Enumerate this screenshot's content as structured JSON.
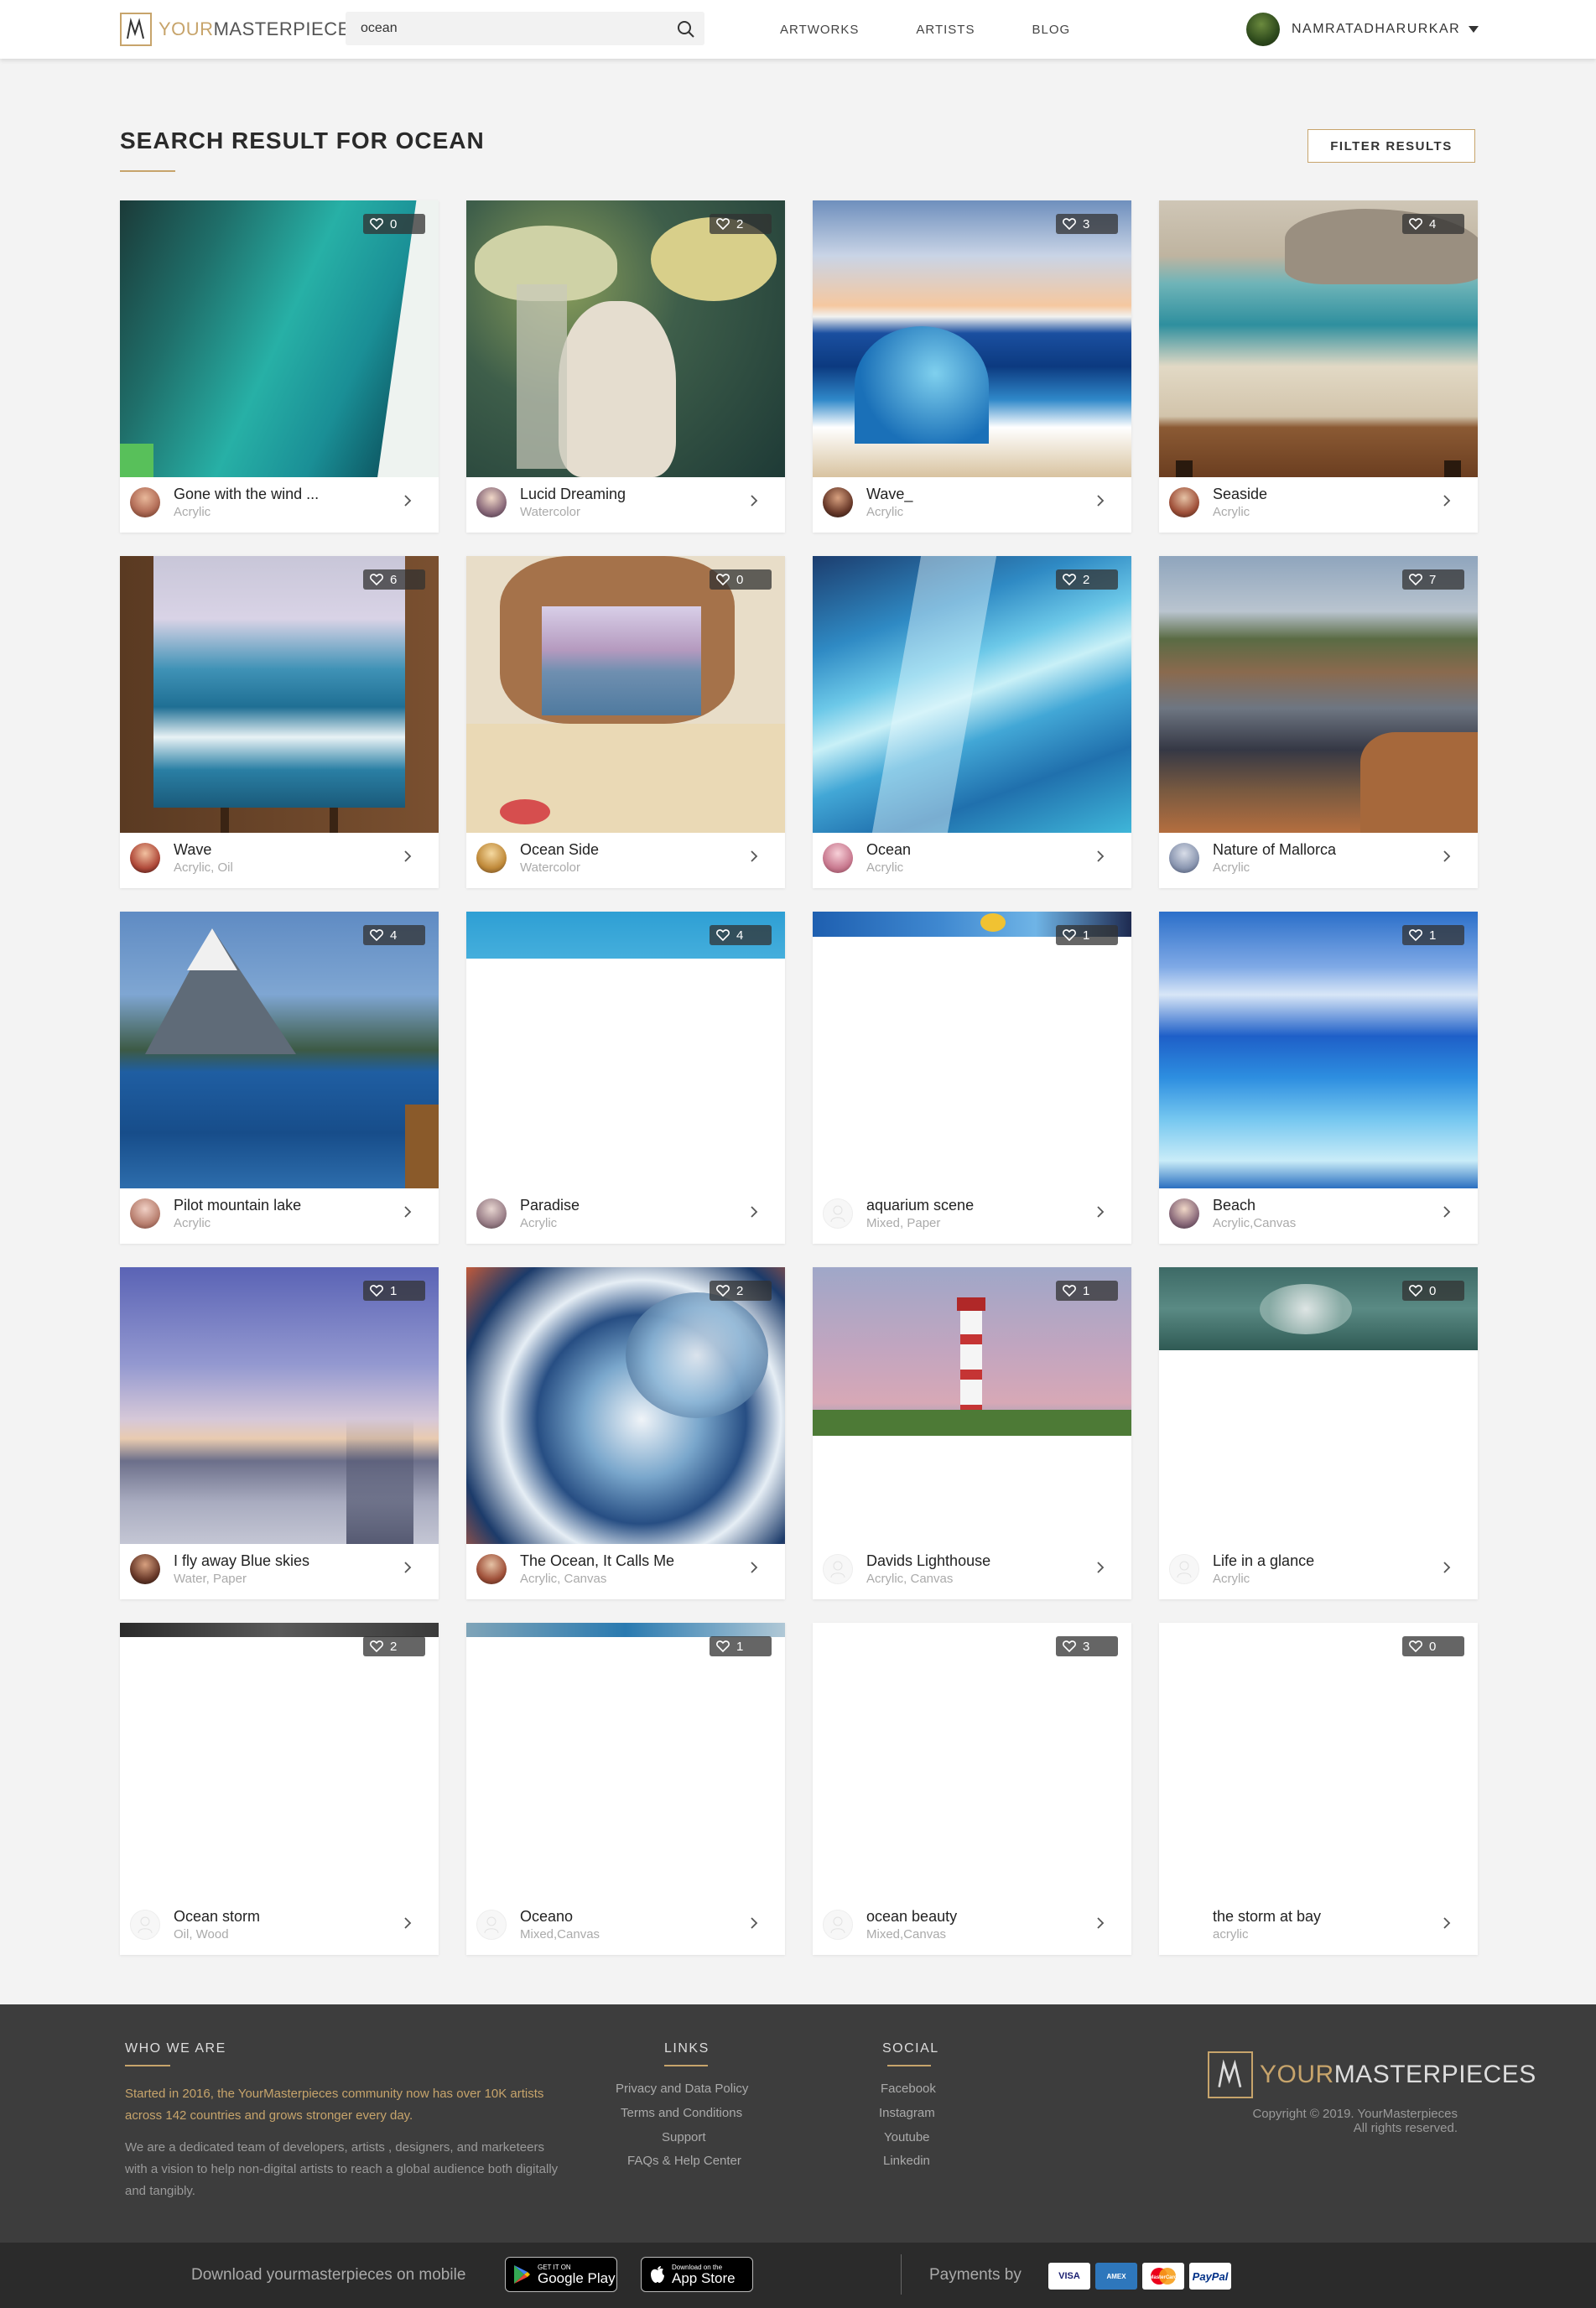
{
  "header": {
    "logo_your": "YOUR",
    "logo_rest": "MASTERPIECES",
    "search_value": "ocean",
    "nav": [
      "ARTWORKS",
      "ARTISTS",
      "BLOG"
    ],
    "user_name": "NAMRATADHARURKAR"
  },
  "main": {
    "title": "SEARCH RESULT FOR OCEAN",
    "filter_label": "FILTER RESULTS"
  },
  "artworks": [
    {
      "title": "Gone with the wind ...",
      "medium": "Acrylic",
      "likes": "0",
      "image": "green-teal-abstract",
      "image_fill": 1.0,
      "avatar": "photo"
    },
    {
      "title": "Lucid Dreaming",
      "medium": "Watercolor",
      "likes": "2",
      "image": "jellyfish-woman",
      "image_fill": 1.0,
      "avatar": "photo"
    },
    {
      "title": "Wave_",
      "medium": "Acrylic",
      "likes": "3",
      "image": "blue-wave",
      "image_fill": 1.0,
      "avatar": "photo"
    },
    {
      "title": "Seaside",
      "medium": "Acrylic",
      "likes": "4",
      "image": "seaside-rocks",
      "image_fill": 1.0,
      "avatar": "photo"
    },
    {
      "title": "Wave",
      "medium": "Acrylic, Oil",
      "likes": "6",
      "image": "wave-on-easel",
      "image_fill": 1.0,
      "avatar": "photo"
    },
    {
      "title": "Ocean Side",
      "medium": "Watercolor",
      "likes": "0",
      "image": "rock-arch-beach",
      "image_fill": 1.0,
      "avatar": "photo"
    },
    {
      "title": "Ocean",
      "medium": "Acrylic",
      "likes": "2",
      "image": "blue-pour",
      "image_fill": 1.0,
      "avatar": "photo"
    },
    {
      "title": "Nature of Mallorca",
      "medium": "Acrylic",
      "likes": "7",
      "image": "mallorca-coast",
      "image_fill": 1.0,
      "avatar": "photo"
    },
    {
      "title": "Pilot mountain lake",
      "medium": "Acrylic",
      "likes": "4",
      "image": "mountain-lake",
      "image_fill": 1.0,
      "avatar": "photo"
    },
    {
      "title": "Paradise",
      "medium": "Acrylic",
      "likes": "4",
      "image": "sea-strip",
      "image_fill": 0.17,
      "avatar": "photo"
    },
    {
      "title": "aquarium scene",
      "medium": "Mixed, Paper",
      "likes": "1",
      "image": "aquarium-strip",
      "image_fill": 0.09,
      "avatar": "placeholder"
    },
    {
      "title": "Beach",
      "medium": "Acrylic,Canvas",
      "likes": "1",
      "image": "beach-sky",
      "image_fill": 1.0,
      "avatar": "photo"
    },
    {
      "title": "I fly away Blue skies",
      "medium": "Water, Paper",
      "likes": "1",
      "image": "purple-sky",
      "image_fill": 1.0,
      "avatar": "photo"
    },
    {
      "title": "The Ocean, It Calls Me",
      "medium": "Acrylic, Canvas",
      "likes": "2",
      "image": "fluid-pour",
      "image_fill": 1.0,
      "avatar": "photo"
    },
    {
      "title": "Davids Lighthouse",
      "medium": "Acrylic, Canvas",
      "likes": "1",
      "image": "lighthouse",
      "image_fill": 0.61,
      "avatar": "placeholder"
    },
    {
      "title": "Life in a glance",
      "medium": "Acrylic",
      "likes": "0",
      "image": "green-wave",
      "image_fill": 0.3,
      "avatar": "placeholder"
    },
    {
      "title": "Ocean storm",
      "medium": "Oil, Wood",
      "likes": "2",
      "image": "dark-strip",
      "image_fill": 0.05,
      "avatar": "placeholder"
    },
    {
      "title": "Oceano",
      "medium": "Mixed,Canvas",
      "likes": "1",
      "image": "blue-strip",
      "image_fill": 0.05,
      "avatar": "placeholder"
    },
    {
      "title": "ocean beauty",
      "medium": "Mixed,Canvas",
      "likes": "3",
      "image": "none",
      "image_fill": 0,
      "avatar": "placeholder"
    },
    {
      "title": "the storm at bay",
      "medium": "acrylic",
      "likes": "0",
      "image": "none",
      "image_fill": 0,
      "avatar": "none"
    }
  ],
  "footer": {
    "who_title": "WHO WE ARE",
    "who_highlight": "Started in 2016, the YourMasterpieces community now has over 10K artists across 142 countries and grows stronger every day.",
    "who_text": "We are a dedicated team of developers, artists , designers, and marketeers with a vision to help non-digital artists to reach a global audience both digitally and tangibly.",
    "links_title": "LINKS",
    "links": [
      "Privacy and Data Policy",
      "Terms and Conditions",
      "Support",
      "FAQs & Help Center"
    ],
    "social_title": "SOCIAL",
    "social": [
      "Facebook",
      "Instagram",
      "Youtube",
      "Linkedin"
    ],
    "logo_your": "YOUR",
    "logo_rest": "MASTERPIECES",
    "copyright_1": "Copyright © 2019. YourMasterpieces",
    "copyright_2": "All rights reserved.",
    "download_text": "Download yourmasterpieces on mobile",
    "google_small": "GET IT ON",
    "google_big": "Google Play",
    "apple_small": "Download on the",
    "apple_big": "App Store",
    "payments_text": "Payments by",
    "payment_methods": [
      "VISA",
      "AMEX",
      "MasterCard",
      "PayPal"
    ]
  }
}
